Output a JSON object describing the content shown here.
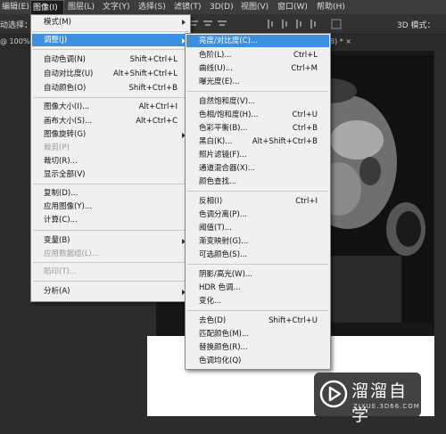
{
  "menubar": {
    "items": [
      "编辑(E)",
      "图像(I)",
      "图层(L)",
      "文字(Y)",
      "选择(S)",
      "滤镜(T)",
      "3D(D)",
      "视图(V)",
      "窗口(W)",
      "帮助(H)"
    ]
  },
  "options_bar": {
    "label": "动选择：",
    "mode_label": "3D 模式："
  },
  "tabbar": {
    "zoom": "@ 100%",
    "doc_tab_suffix": "8) * ×"
  },
  "image_menu": {
    "mode": "模式(M)",
    "adjust": "调整(J)",
    "auto_tone": {
      "label": "自动色调(N)",
      "shortcut": "Shift+Ctrl+L"
    },
    "auto_contrast": {
      "label": "自动对比度(U)",
      "shortcut": "Alt+Shift+Ctrl+L"
    },
    "auto_color": {
      "label": "自动颜色(O)",
      "shortcut": "Shift+Ctrl+B"
    },
    "image_size": {
      "label": "图像大小(I)...",
      "shortcut": "Alt+Ctrl+I"
    },
    "canvas_size": {
      "label": "画布大小(S)...",
      "shortcut": "Alt+Ctrl+C"
    },
    "rotation": "图像旋转(G)",
    "crop": "裁剪(P)",
    "trim": "裁切(R)...",
    "reveal_all": "显示全部(V)",
    "duplicate": "复制(D)...",
    "apply_image": "应用图像(Y)...",
    "calculations": "计算(C)...",
    "variables": "变量(B)",
    "apply_dataset": "应用数据组(L)...",
    "trap": "陷印(T)...",
    "analysis": "分析(A)"
  },
  "adjust_menu": {
    "brightness_contrast": "亮度/对比度(C)...",
    "levels": {
      "label": "色阶(L)...",
      "shortcut": "Ctrl+L"
    },
    "curves": {
      "label": "曲线(U)...",
      "shortcut": "Ctrl+M"
    },
    "exposure": "曝光度(E)...",
    "vibrance": "自然饱和度(V)...",
    "hue_saturation": {
      "label": "色相/饱和度(H)...",
      "shortcut": "Ctrl+U"
    },
    "color_balance": {
      "label": "色彩平衡(B)...",
      "shortcut": "Ctrl+B"
    },
    "black_white": {
      "label": "黑白(K)...",
      "shortcut": "Alt+Shift+Ctrl+B"
    },
    "photo_filter": "照片滤镜(F)...",
    "channel_mixer": "通道混合器(X)...",
    "color_lookup": "颜色查找...",
    "invert": {
      "label": "反相(I)",
      "shortcut": "Ctrl+I"
    },
    "posterize": "色调分离(P)...",
    "threshold": "阈值(T)...",
    "gradient_map": "渐变映射(G)...",
    "selective_color": "可选颜色(S)...",
    "shadows_highlights": "阴影/高光(W)...",
    "hdr_toning": "HDR 色调...",
    "variations": "变化...",
    "desaturate": {
      "label": "去色(D)",
      "shortcut": "Shift+Ctrl+U"
    },
    "match_color": "匹配颜色(M)...",
    "replace_color": "替换颜色(R)...",
    "equalize": "色调均化(Q)"
  },
  "watermark": {
    "title": "溜溜自学",
    "subtitle": "ZIXUE.3D66.COM"
  },
  "colors": {
    "highlight": "#3d8fdf",
    "menu_bg": "#f0f0f0",
    "app_bg": "#282828"
  }
}
